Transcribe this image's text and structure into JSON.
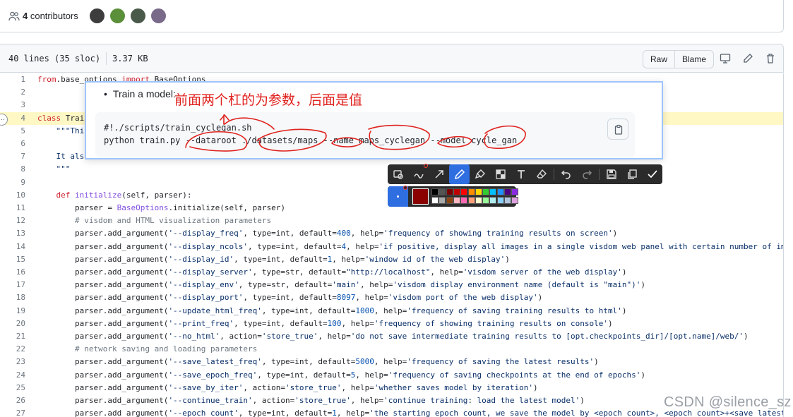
{
  "contributors": {
    "count": "4",
    "label": " contributors",
    "avatars": [
      {
        "name": "avatar-1",
        "color": "#3d3d3d"
      },
      {
        "name": "avatar-2",
        "color": "#5c8f3a"
      },
      {
        "name": "avatar-3",
        "color": "#4a5a4a"
      },
      {
        "name": "avatar-4",
        "color": "#7a6a8a"
      }
    ]
  },
  "file_header": {
    "lines": "40 lines (35 sloc)",
    "size": "3.37 KB",
    "raw_label": "Raw",
    "blame_label": "Blame"
  },
  "code": {
    "line_numbers": [
      "1",
      "2",
      "3",
      "4",
      "5",
      "6",
      "7",
      "8",
      "9",
      "10",
      "11",
      "12",
      "13",
      "14",
      "15",
      "16",
      "17",
      "18",
      "19",
      "20",
      "21",
      "22",
      "23",
      "24",
      "25",
      "26",
      "27"
    ],
    "lines": [
      {
        "segments": [
          [
            "k",
            "from"
          ],
          [
            "",
            ".base_options "
          ],
          [
            "k",
            "import"
          ],
          [
            "",
            " BaseOptions"
          ]
        ]
      },
      {
        "segments": []
      },
      {
        "segments": []
      },
      {
        "segments": [
          [
            "k",
            "class"
          ],
          [
            "",
            " Trai"
          ]
        ]
      },
      {
        "segments": [
          [
            "s",
            "    \"\"\"Thi"
          ]
        ]
      },
      {
        "segments": []
      },
      {
        "segments": [
          [
            "s",
            "    It als"
          ]
        ]
      },
      {
        "segments": [
          [
            "s",
            "    \"\"\""
          ]
        ]
      },
      {
        "segments": []
      },
      {
        "segments": [
          [
            "k",
            "    def"
          ],
          [
            "f",
            " initialize"
          ],
          [
            "",
            "(self, parser):"
          ]
        ]
      },
      {
        "segments": [
          [
            "",
            "        parser = "
          ],
          [
            "f",
            "BaseOptions"
          ],
          [
            "",
            ".initialize(self, parser)"
          ]
        ]
      },
      {
        "segments": [
          [
            "c",
            "        # visdom and HTML visualization parameters"
          ]
        ]
      },
      {
        "segments": [
          [
            "",
            "        parser.add_argument("
          ],
          [
            "s",
            "'--display_freq'"
          ],
          [
            "",
            ", type=int, default="
          ],
          [
            "n",
            "400"
          ],
          [
            "",
            ", help="
          ],
          [
            "s",
            "'frequency of showing training results on screen'"
          ],
          [
            "",
            ")"
          ]
        ]
      },
      {
        "segments": [
          [
            "",
            "        parser.add_argument("
          ],
          [
            "s",
            "'--display_ncols'"
          ],
          [
            "",
            ", type=int, default="
          ],
          [
            "n",
            "4"
          ],
          [
            "",
            ", help="
          ],
          [
            "s",
            "'if positive, display all images in a single visdom web panel with certain number of im"
          ]
        ]
      },
      {
        "segments": [
          [
            "",
            "        parser.add_argument("
          ],
          [
            "s",
            "'--display_id'"
          ],
          [
            "",
            ", type=int, default="
          ],
          [
            "n",
            "1"
          ],
          [
            "",
            ", help="
          ],
          [
            "s",
            "'window id of the web display'"
          ],
          [
            "",
            ")"
          ]
        ]
      },
      {
        "segments": [
          [
            "",
            "        parser.add_argument("
          ],
          [
            "s",
            "'--display_server'"
          ],
          [
            "",
            ", type=str, default="
          ],
          [
            "s",
            "\"http://localhost\""
          ],
          [
            "",
            ", help="
          ],
          [
            "s",
            "'visdom server of the web display'"
          ],
          [
            "",
            ")"
          ]
        ]
      },
      {
        "segments": [
          [
            "",
            "        parser.add_argument("
          ],
          [
            "s",
            "'--display_env'"
          ],
          [
            "",
            ", type=str, default="
          ],
          [
            "s",
            "'main'"
          ],
          [
            "",
            ", help="
          ],
          [
            "s",
            "'visdom display environment name (default is \"main\")'"
          ],
          [
            "",
            ")"
          ]
        ]
      },
      {
        "segments": [
          [
            "",
            "        parser.add_argument("
          ],
          [
            "s",
            "'--display_port'"
          ],
          [
            "",
            ", type=int, default="
          ],
          [
            "n",
            "8097"
          ],
          [
            "",
            ", help="
          ],
          [
            "s",
            "'visdom port of the web display'"
          ],
          [
            "",
            ")"
          ]
        ]
      },
      {
        "segments": [
          [
            "",
            "        parser.add_argument("
          ],
          [
            "s",
            "'--update_html_freq'"
          ],
          [
            "",
            ", type=int, default="
          ],
          [
            "n",
            "1000"
          ],
          [
            "",
            ", help="
          ],
          [
            "s",
            "'frequency of saving training results to html'"
          ],
          [
            "",
            ")"
          ]
        ]
      },
      {
        "segments": [
          [
            "",
            "        parser.add_argument("
          ],
          [
            "s",
            "'--print_freq'"
          ],
          [
            "",
            ", type=int, default="
          ],
          [
            "n",
            "100"
          ],
          [
            "",
            ", help="
          ],
          [
            "s",
            "'frequency of showing training results on console'"
          ],
          [
            "",
            ")"
          ]
        ]
      },
      {
        "segments": [
          [
            "",
            "        parser.add_argument("
          ],
          [
            "s",
            "'--no_html'"
          ],
          [
            "",
            ", action="
          ],
          [
            "s",
            "'store_true'"
          ],
          [
            "",
            ", help="
          ],
          [
            "s",
            "'do not save intermediate training results to [opt.checkpoints_dir]/[opt.name]/web/'"
          ],
          [
            "",
            ")"
          ]
        ]
      },
      {
        "segments": [
          [
            "c",
            "        # network saving and loading parameters"
          ]
        ]
      },
      {
        "segments": [
          [
            "",
            "        parser.add_argument("
          ],
          [
            "s",
            "'--save_latest_freq'"
          ],
          [
            "",
            ", type=int, default="
          ],
          [
            "n",
            "5000"
          ],
          [
            "",
            ", help="
          ],
          [
            "s",
            "'frequency of saving the latest results'"
          ],
          [
            "",
            ")"
          ]
        ]
      },
      {
        "segments": [
          [
            "",
            "        parser.add_argument("
          ],
          [
            "s",
            "'--save_epoch_freq'"
          ],
          [
            "",
            ", type=int, default="
          ],
          [
            "n",
            "5"
          ],
          [
            "",
            ", help="
          ],
          [
            "s",
            "'frequency of saving checkpoints at the end of epochs'"
          ],
          [
            "",
            ")"
          ]
        ]
      },
      {
        "segments": [
          [
            "",
            "        parser.add_argument("
          ],
          [
            "s",
            "'--save_by_iter'"
          ],
          [
            "",
            ", action="
          ],
          [
            "s",
            "'store_true'"
          ],
          [
            "",
            ", help="
          ],
          [
            "s",
            "'whether saves model by iteration'"
          ],
          [
            "",
            ")"
          ]
        ]
      },
      {
        "segments": [
          [
            "",
            "        parser.add_argument("
          ],
          [
            "s",
            "'--continue_train'"
          ],
          [
            "",
            ", action="
          ],
          [
            "s",
            "'store_true'"
          ],
          [
            "",
            ", help="
          ],
          [
            "s",
            "'continue training: load the latest model'"
          ],
          [
            "",
            ")"
          ]
        ]
      },
      {
        "segments": [
          [
            "",
            "        parser.add_argument("
          ],
          [
            "s",
            "'--epoch_count'"
          ],
          [
            "",
            ", type=int, default="
          ],
          [
            "n",
            "1"
          ],
          [
            "",
            ", help="
          ],
          [
            "s",
            "'the starting epoch count, we save the model by <epoch_count>, <epoch_count>+<save_latest"
          ]
        ]
      }
    ]
  },
  "popup": {
    "bullet": "Train a model:",
    "code_line1": "#!./scripts/train_cyclegan.sh",
    "code_line2": "python train.py --dataroot ./datasets/maps --name maps_cyclegan --model cycle_gan"
  },
  "annotation": {
    "text": "前面两个杠的为参数，后面是值",
    "ink_color": "#e0211d"
  },
  "toolbar": {
    "tools": [
      "rectangle-icon",
      "curve-icon",
      "arrow-icon",
      "pen-icon",
      "marker-icon",
      "mosaic-icon",
      "text-icon",
      "eraser-icon",
      "undo-icon",
      "redo-icon",
      "save-icon",
      "copy-icon",
      "check-icon"
    ],
    "active_tool": "pen-icon",
    "current_color": "#8b0000",
    "swatches_row1": [
      "#000000",
      "#555555",
      "#7a0000",
      "#c00000",
      "#ff0000",
      "#ff8c00",
      "#ffd700",
      "#32cd32",
      "#00bfff",
      "#1e90ff",
      "#4b0082",
      "#8a2be2"
    ],
    "swatches_row2": [
      "#ffffff",
      "#aaaaaa",
      "#8b4513",
      "#ffb6c1",
      "#ff69b4",
      "#ffa07a",
      "#fffacd",
      "#98fb98",
      "#afeeee",
      "#87cefa",
      "#b0c4de",
      "#dda0dd"
    ]
  },
  "watermark": "CSDN @silence_sz"
}
